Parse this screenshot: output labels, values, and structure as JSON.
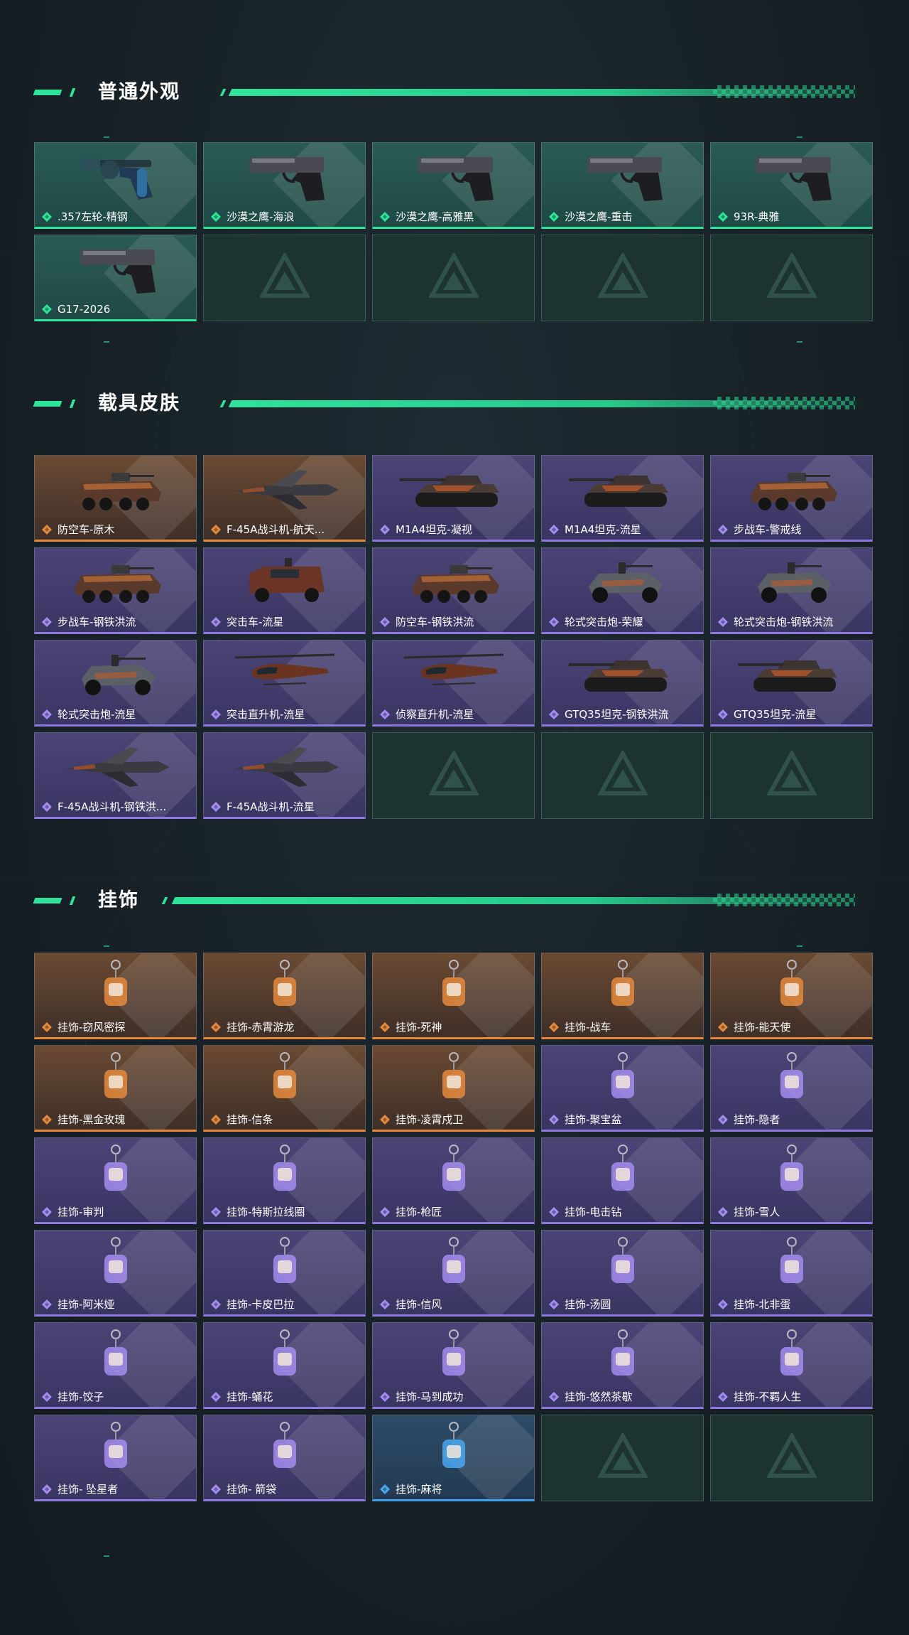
{
  "colors": {
    "accent": "#2fe39a",
    "green_rarity": "#2fe39a",
    "orange_rarity": "#e58a3c",
    "purple_rarity": "#8f78e0",
    "blue_rarity": "#3fa0ee"
  },
  "sections": [
    {
      "title": "普通外观",
      "items": [
        {
          "name": ".357左轮-精钢",
          "rarity": "green",
          "icon": "revolver-icon"
        },
        {
          "name": "沙漠之鹰-海浪",
          "rarity": "green",
          "icon": "pistol-icon"
        },
        {
          "name": "沙漠之鹰-高雅黑",
          "rarity": "green",
          "icon": "pistol-icon"
        },
        {
          "name": "沙漠之鹰-重击",
          "rarity": "green",
          "icon": "pistol-icon"
        },
        {
          "name": "93R-典雅",
          "rarity": "green",
          "icon": "pistol-icon"
        },
        {
          "name": "G17-2026",
          "rarity": "green",
          "icon": "pistol-icon"
        },
        {
          "name": "",
          "rarity": "empty",
          "icon": "logo-icon"
        },
        {
          "name": "",
          "rarity": "empty",
          "icon": "logo-icon"
        },
        {
          "name": "",
          "rarity": "empty",
          "icon": "logo-icon"
        },
        {
          "name": "",
          "rarity": "empty",
          "icon": "logo-icon"
        }
      ]
    },
    {
      "title": "载具皮肤",
      "items": [
        {
          "name": "防空车-原木",
          "rarity": "orange",
          "icon": "armored-vehicle-icon"
        },
        {
          "name": "F-45A战斗机-航天...",
          "rarity": "orange",
          "icon": "jet-icon"
        },
        {
          "name": "M1A4坦克-凝视",
          "rarity": "purple",
          "icon": "tank-icon"
        },
        {
          "name": "M1A4坦克-流星",
          "rarity": "purple",
          "icon": "tank-icon"
        },
        {
          "name": "步战车-警戒线",
          "rarity": "purple",
          "icon": "armored-vehicle-icon"
        },
        {
          "name": "步战车-钢铁洪流",
          "rarity": "purple",
          "icon": "armored-vehicle-icon"
        },
        {
          "name": "突击车-流星",
          "rarity": "purple",
          "icon": "truck-icon"
        },
        {
          "name": "防空车-钢铁洪流",
          "rarity": "purple",
          "icon": "armored-vehicle-icon"
        },
        {
          "name": "轮式突击炮-荣耀",
          "rarity": "purple",
          "icon": "buggy-icon"
        },
        {
          "name": "轮式突击炮-钢铁洪流",
          "rarity": "purple",
          "icon": "buggy-icon"
        },
        {
          "name": "轮式突击炮-流星",
          "rarity": "purple",
          "icon": "buggy-icon"
        },
        {
          "name": "突击直升机-流星",
          "rarity": "purple",
          "icon": "helicopter-icon"
        },
        {
          "name": "侦察直升机-流星",
          "rarity": "purple",
          "icon": "helicopter-icon"
        },
        {
          "name": "GTQ35坦克-钢铁洪流",
          "rarity": "purple",
          "icon": "tank-icon"
        },
        {
          "name": "GTQ35坦克-流星",
          "rarity": "purple",
          "icon": "tank-icon"
        },
        {
          "name": "F-45A战斗机-钢铁洪...",
          "rarity": "purple",
          "icon": "jet-icon"
        },
        {
          "name": "F-45A战斗机-流星",
          "rarity": "purple",
          "icon": "jet-icon"
        },
        {
          "name": "",
          "rarity": "empty",
          "icon": "logo-icon"
        },
        {
          "name": "",
          "rarity": "empty",
          "icon": "logo-icon"
        },
        {
          "name": "",
          "rarity": "empty",
          "icon": "logo-icon"
        }
      ]
    },
    {
      "title": "挂饰",
      "items": [
        {
          "name": "挂饰-窃风密探",
          "rarity": "orange",
          "icon": "charm-icon"
        },
        {
          "name": "挂饰-赤霄游龙",
          "rarity": "orange",
          "icon": "charm-icon"
        },
        {
          "name": "挂饰-死神",
          "rarity": "orange",
          "icon": "charm-icon"
        },
        {
          "name": "挂饰-战车",
          "rarity": "orange",
          "icon": "charm-icon"
        },
        {
          "name": "挂饰-能天使",
          "rarity": "orange",
          "icon": "charm-icon"
        },
        {
          "name": "挂饰-黑金玫瑰",
          "rarity": "orange",
          "icon": "charm-icon"
        },
        {
          "name": "挂饰-信条",
          "rarity": "orange",
          "icon": "charm-icon"
        },
        {
          "name": "挂饰-凌霄戍卫",
          "rarity": "orange",
          "icon": "charm-icon"
        },
        {
          "name": "挂饰-聚宝盆",
          "rarity": "purple",
          "icon": "charm-icon"
        },
        {
          "name": "挂饰-隐者",
          "rarity": "purple",
          "icon": "charm-icon"
        },
        {
          "name": "挂饰-审判",
          "rarity": "purple",
          "icon": "charm-icon"
        },
        {
          "name": "挂饰-特斯拉线圈",
          "rarity": "purple",
          "icon": "charm-icon"
        },
        {
          "name": "挂饰-枪匠",
          "rarity": "purple",
          "icon": "charm-icon"
        },
        {
          "name": "挂饰-电击钻",
          "rarity": "purple",
          "icon": "charm-icon"
        },
        {
          "name": "挂饰-雪人",
          "rarity": "purple",
          "icon": "charm-icon"
        },
        {
          "name": "挂饰-阿米娅",
          "rarity": "purple",
          "icon": "charm-icon"
        },
        {
          "name": "挂饰-卡皮巴拉",
          "rarity": "purple",
          "icon": "charm-icon"
        },
        {
          "name": "挂饰-信风",
          "rarity": "purple",
          "icon": "charm-icon"
        },
        {
          "name": "挂饰-汤圆",
          "rarity": "purple",
          "icon": "charm-icon"
        },
        {
          "name": "挂饰-北非蛋",
          "rarity": "purple",
          "icon": "charm-icon"
        },
        {
          "name": "挂饰-饺子",
          "rarity": "purple",
          "icon": "charm-icon"
        },
        {
          "name": "挂饰-蛹花",
          "rarity": "purple",
          "icon": "charm-icon"
        },
        {
          "name": "挂饰-马到成功",
          "rarity": "purple",
          "icon": "charm-icon"
        },
        {
          "name": "挂饰-悠然茶歇",
          "rarity": "purple",
          "icon": "charm-icon"
        },
        {
          "name": "挂饰-不羁人生",
          "rarity": "purple",
          "icon": "charm-icon"
        },
        {
          "name": "挂饰- 坠星者",
          "rarity": "purple",
          "icon": "charm-icon"
        },
        {
          "name": "挂饰- 箭袋",
          "rarity": "purple",
          "icon": "charm-icon"
        },
        {
          "name": "挂饰-麻将",
          "rarity": "blue",
          "icon": "charm-icon"
        },
        {
          "name": "",
          "rarity": "empty",
          "icon": "logo-icon"
        },
        {
          "name": "",
          "rarity": "empty",
          "icon": "logo-icon"
        }
      ]
    }
  ]
}
